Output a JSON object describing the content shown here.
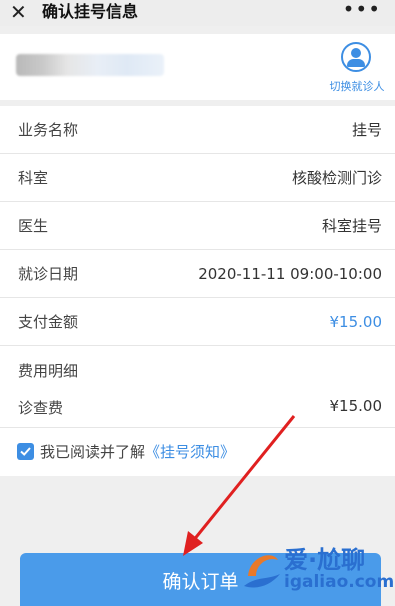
{
  "topbar": {
    "close_icon": "close-icon",
    "title": "确认挂号信息",
    "more_icon": "more-icon"
  },
  "patient": {
    "switch_label": "切换就诊人",
    "switch_icon": "user-switch-icon"
  },
  "rows": [
    {
      "key": "业务名称",
      "value": "挂号"
    },
    {
      "key": "科室",
      "value": "核酸检测门诊"
    },
    {
      "key": "医生",
      "value": "科室挂号"
    },
    {
      "key": "就诊日期",
      "value": "2020-11-11 09:00-10:00"
    },
    {
      "key": "支付金额",
      "value": "¥15.00"
    }
  ],
  "fee": {
    "title": "费用明细",
    "item": "诊查费",
    "amount": "¥15.00"
  },
  "agree": {
    "prefix": "我已阅读并了解",
    "link": "《挂号须知》",
    "checked": true
  },
  "confirm_label": "确认订单",
  "watermark": {
    "line1": "爱·尬聊",
    "line2": "igaliao.com"
  },
  "colors": {
    "accent": "#3d8ee3",
    "button": "#4a9bea",
    "arrow": "#e02020"
  }
}
